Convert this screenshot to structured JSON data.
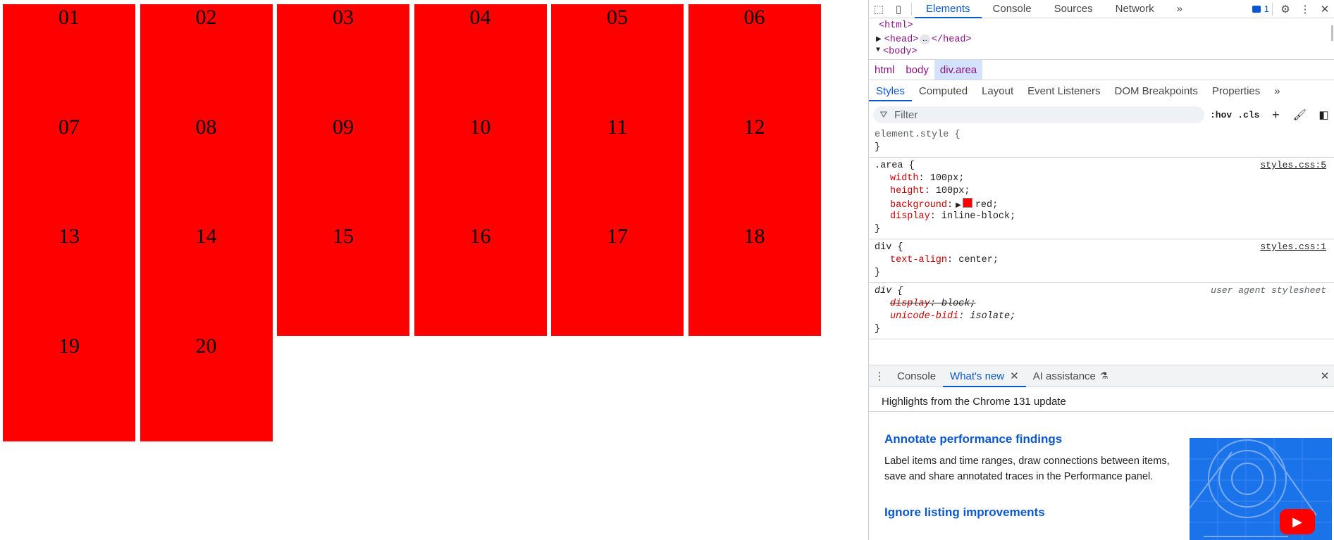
{
  "grid": {
    "cells": [
      "01",
      "02",
      "03",
      "04",
      "05",
      "06",
      "07",
      "08",
      "09",
      "10",
      "11",
      "12",
      "13",
      "14",
      "15",
      "16",
      "17",
      "18",
      "19",
      "20"
    ],
    "color": "#ff0000"
  },
  "devtools": {
    "topbar": {
      "tabs": [
        "Elements",
        "Console",
        "Sources",
        "Network"
      ],
      "active_tab": "Elements",
      "more": "»",
      "issues_count": "1"
    },
    "dom_tree": {
      "html_open": "<html>",
      "head_open": "<head>",
      "head_ellipsis": "…",
      "head_close": "</head>",
      "body_partial": "<body>"
    },
    "breadcrumb": [
      "html",
      "body",
      "div.area"
    ],
    "subtabs": [
      "Styles",
      "Computed",
      "Layout",
      "Event Listeners",
      "DOM Breakpoints",
      "Properties"
    ],
    "subtabs_more": "»",
    "filter": {
      "placeholder": "Filter",
      "hov": ":hov",
      "cls": ".cls"
    },
    "rules": {
      "element_style": {
        "selector": "element.style {",
        "close": "}"
      },
      "area": {
        "selector": ".area {",
        "source": "styles.css:5",
        "props": [
          {
            "name": "width",
            "value": "100px;"
          },
          {
            "name": "height",
            "value": "100px;"
          },
          {
            "name": "background",
            "value": "red;"
          },
          {
            "name": "display",
            "value": "inline-block;"
          }
        ],
        "close": "}"
      },
      "div": {
        "selector": "div {",
        "source": "styles.css:1",
        "props": [
          {
            "name": "text-align",
            "value": "center;"
          }
        ],
        "close": "}"
      },
      "ua": {
        "selector": "div {",
        "source": "user agent stylesheet",
        "props": [
          {
            "name": "display",
            "value": "block;"
          },
          {
            "name": "unicode-bidi",
            "value": "isolate;"
          }
        ],
        "close": "}"
      }
    },
    "drawer": {
      "tabs": [
        "Console",
        "What's new",
        "AI assistance"
      ],
      "active_tab": "What's new",
      "highlights": "Highlights from the Chrome 131 update",
      "article1_title": "Annotate performance findings",
      "article1_body": "Label items and time ranges, draw connections between items, save and share annotated traces in the Performance panel.",
      "article2_title": "Ignore listing improvements"
    }
  }
}
